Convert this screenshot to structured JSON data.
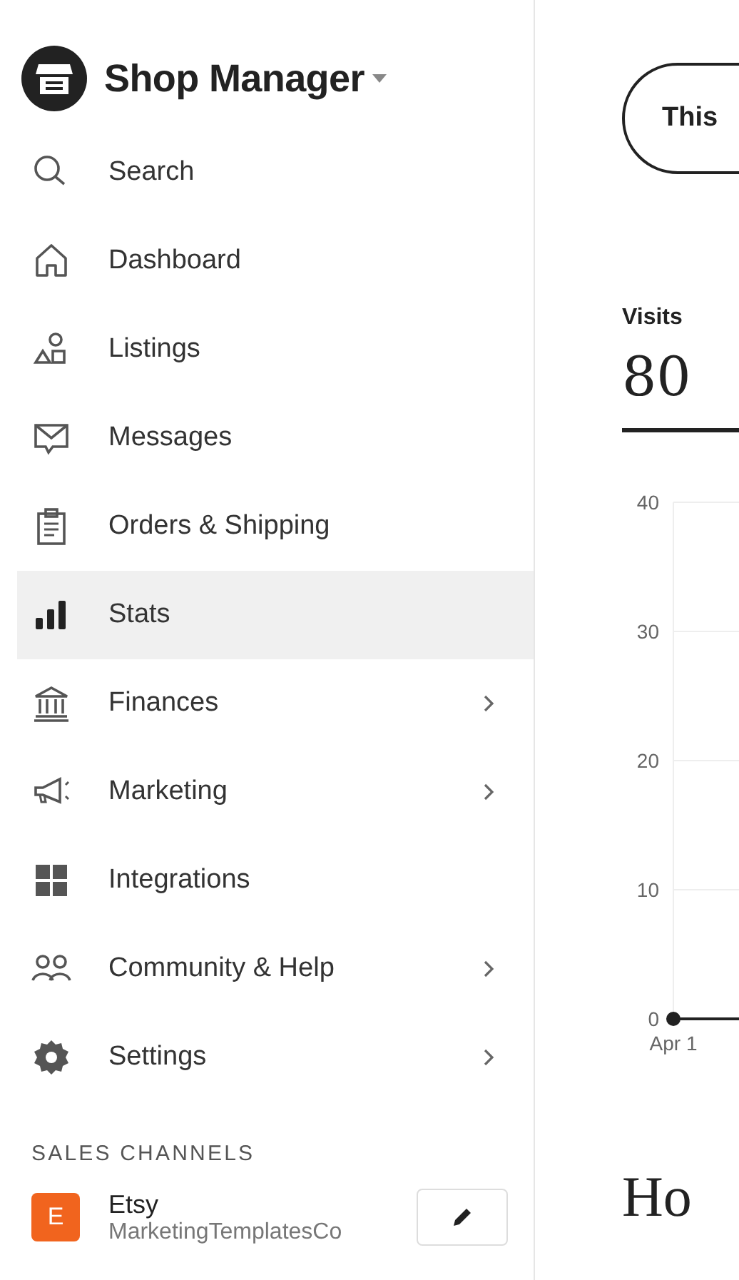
{
  "sidebar": {
    "title": "Shop Manager",
    "items": [
      {
        "label": "Search",
        "selected": false,
        "submenu": false
      },
      {
        "label": "Dashboard",
        "selected": false,
        "submenu": false
      },
      {
        "label": "Listings",
        "selected": false,
        "submenu": false
      },
      {
        "label": "Messages",
        "selected": false,
        "submenu": false
      },
      {
        "label": "Orders & Shipping",
        "selected": false,
        "submenu": false
      },
      {
        "label": "Stats",
        "selected": true,
        "submenu": false
      },
      {
        "label": "Finances",
        "selected": false,
        "submenu": true
      },
      {
        "label": "Marketing",
        "selected": false,
        "submenu": true
      },
      {
        "label": "Integrations",
        "selected": false,
        "submenu": false
      },
      {
        "label": "Community & Help",
        "selected": false,
        "submenu": true
      },
      {
        "label": "Settings",
        "selected": false,
        "submenu": true
      }
    ],
    "sales_channels": {
      "heading": "SALES CHANNELS",
      "channels": [
        {
          "badge": "E",
          "name": "Etsy",
          "shop": "MarketingTemplatesCo",
          "color": "#f1641e"
        }
      ]
    }
  },
  "main": {
    "range_button": "This",
    "metric": {
      "label": "Visits",
      "value": "80"
    },
    "chart_data": {
      "type": "line",
      "grid": true,
      "x": [
        "Apr 1"
      ],
      "yticks": [
        0,
        10,
        20,
        30,
        40
      ],
      "ylim": [
        0,
        40
      ],
      "series": [
        {
          "color": "#222222",
          "marker": "circle",
          "values": [
            0
          ]
        }
      ]
    },
    "section_heading": "Ho"
  }
}
